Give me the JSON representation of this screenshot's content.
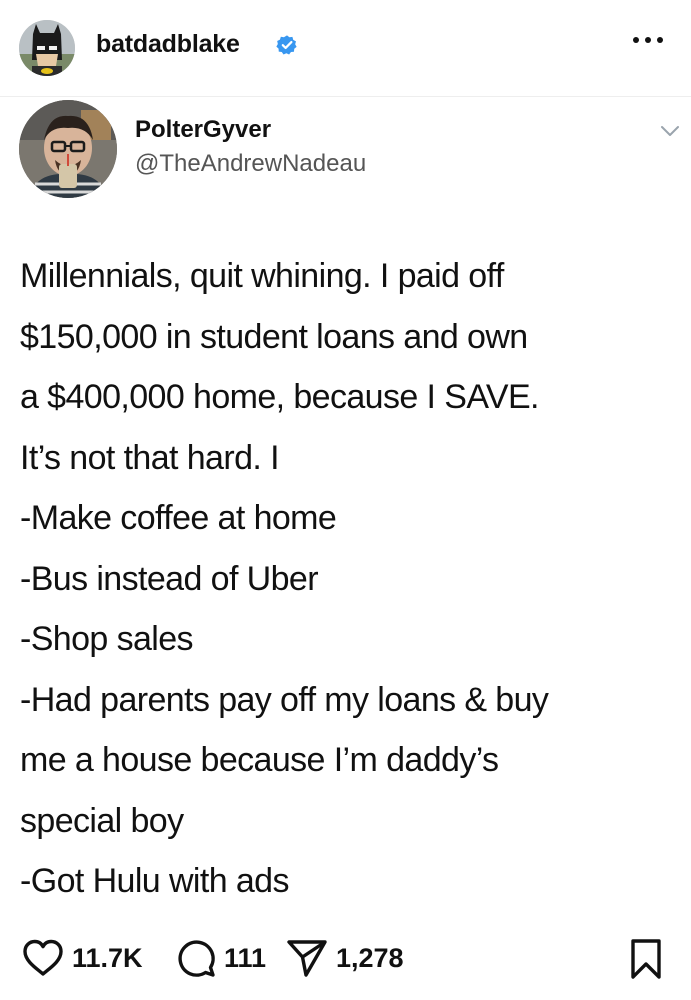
{
  "post": {
    "username": "batdadblake",
    "verified": true,
    "more_icon": "more-horizontal-icon"
  },
  "tweet": {
    "display_name": "PolterGyver",
    "handle": "@TheAndrewNadeau",
    "lines": [
      "Millennials, quit whining. I paid off",
      "$150,000 in student loans and own",
      "a $400,000 home, because I SAVE.",
      "It’s not that hard. I",
      "-Make coffee at home",
      "-Bus instead of Uber",
      "-Shop sales",
      "-Had parents pay off my loans & buy",
      "me a house because I’m daddy’s",
      "special boy",
      "-Got Hulu with ads"
    ]
  },
  "actions": {
    "likes": "11.7K",
    "comments": "111",
    "shares": "1,278"
  },
  "colors": {
    "verified_blue": "#3897f0",
    "text": "#111111",
    "handle_gray": "#555555"
  }
}
